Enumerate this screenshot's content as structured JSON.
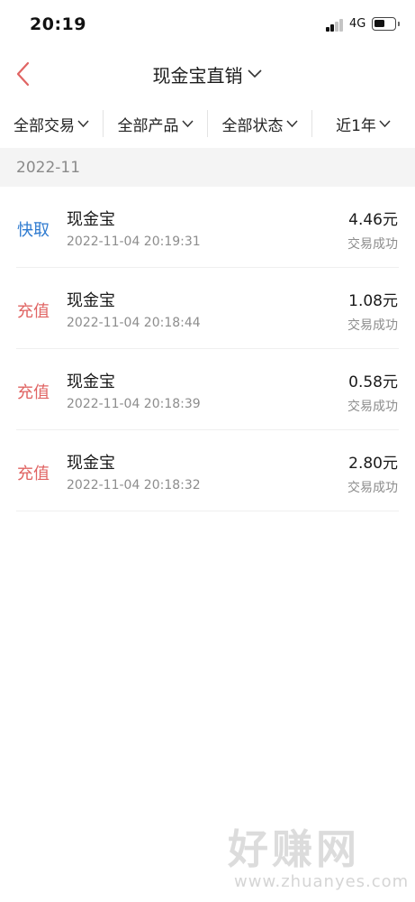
{
  "status_bar": {
    "time": "20:19",
    "network": "4G",
    "icons": [
      "signal-icon",
      "battery-icon"
    ]
  },
  "nav": {
    "title": "现金宝直销",
    "back_icon": "chevron-left-icon",
    "title_icon": "chevron-down-icon",
    "accent_color": "#e06463"
  },
  "filters": [
    {
      "label": "全部交易"
    },
    {
      "label": "全部产品"
    },
    {
      "label": "全部状态"
    },
    {
      "label": "近1年"
    }
  ],
  "month": "2022-11",
  "colors": {
    "withdraw": "#2f7bd0",
    "recharge": "#e06463",
    "secondary_text": "#8d8d8d",
    "section_bg": "#f4f4f4"
  },
  "transactions": [
    {
      "type": "快取",
      "type_color": "blue",
      "product": "现金宝",
      "datetime": "2022-11-04 20:19:31",
      "amount": "4.46元",
      "status": "交易成功"
    },
    {
      "type": "充值",
      "type_color": "red",
      "product": "现金宝",
      "datetime": "2022-11-04 20:18:44",
      "amount": "1.08元",
      "status": "交易成功"
    },
    {
      "type": "充值",
      "type_color": "red",
      "product": "现金宝",
      "datetime": "2022-11-04 20:18:39",
      "amount": "0.58元",
      "status": "交易成功"
    },
    {
      "type": "充值",
      "type_color": "red",
      "product": "现金宝",
      "datetime": "2022-11-04 20:18:32",
      "amount": "2.80元",
      "status": "交易成功"
    }
  ],
  "watermark": {
    "logo_text": "好赚网",
    "url": "www.zhuanyes.com"
  }
}
